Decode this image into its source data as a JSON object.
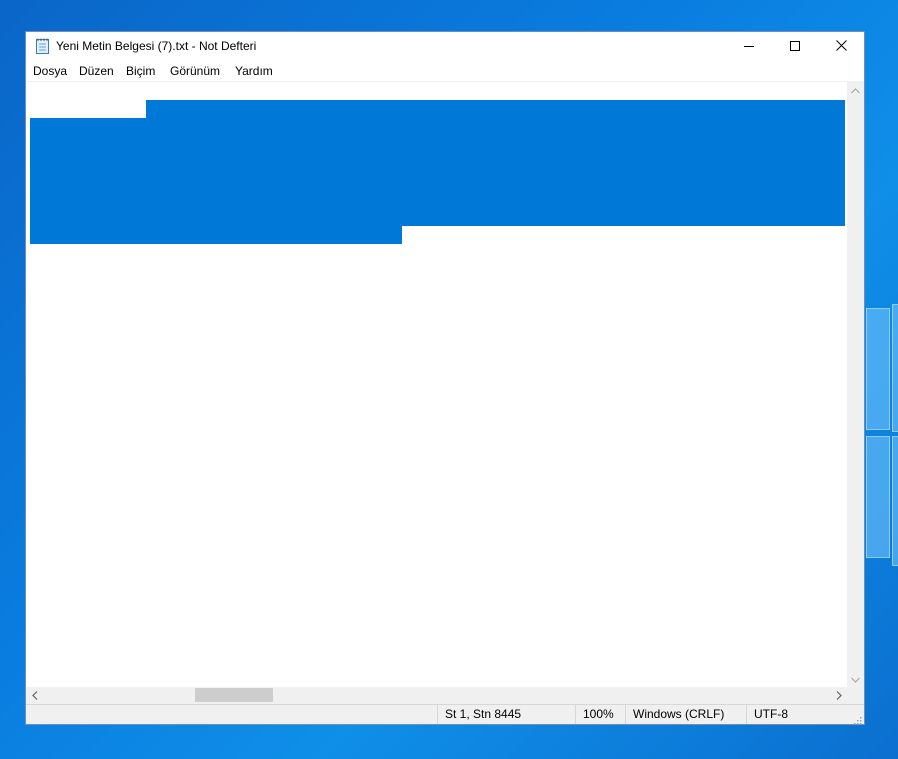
{
  "window": {
    "title": "Yeni Metin Belgesi (7).txt - Not Defteri",
    "app_icon": "notepad-icon"
  },
  "caption_buttons": {
    "minimize_icon": "minimize-icon",
    "maximize_icon": "maximize-icon",
    "close_icon": "close-icon"
  },
  "menu": {
    "items": [
      "Dosya",
      "Düzen",
      "Biçim",
      "Görünüm",
      "Yardım"
    ]
  },
  "editor": {
    "content": "",
    "selection_color": "#0078d7"
  },
  "status": {
    "position": "St 1, Stn 8445",
    "zoom": "100%",
    "line_ending": "Windows (CRLF)",
    "encoding": "UTF-8"
  }
}
